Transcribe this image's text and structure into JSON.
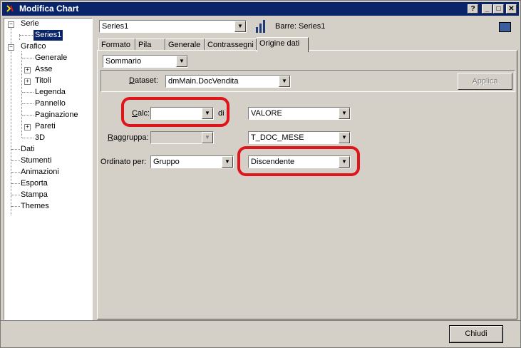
{
  "window": {
    "title": "Modifica Chart",
    "help_btn": "?",
    "min_btn": "_",
    "max_btn": "□",
    "close_btn": "✕"
  },
  "tree": {
    "items": [
      {
        "label": "Serie"
      },
      {
        "label": "Series1"
      },
      {
        "label": "Grafico"
      },
      {
        "label": "Generale"
      },
      {
        "label": "Asse"
      },
      {
        "label": "Titoli"
      },
      {
        "label": "Legenda"
      },
      {
        "label": "Pannello"
      },
      {
        "label": "Paginazione"
      },
      {
        "label": "Pareti"
      },
      {
        "label": "3D"
      },
      {
        "label": "Dati"
      },
      {
        "label": "Stumenti"
      },
      {
        "label": "Animazioni"
      },
      {
        "label": "Esporta"
      },
      {
        "label": "Stampa"
      },
      {
        "label": "Themes"
      }
    ],
    "expand": "−",
    "collapse": "+"
  },
  "series_bar": {
    "series_value": "Series1",
    "series_type": "Barre: Series1",
    "swatch_color": "#3a5f9e"
  },
  "tabs": [
    "Formato",
    "Pila",
    "Generale",
    "Contrassegni",
    "Origine dati"
  ],
  "origine": {
    "mode_value": "Sommario",
    "dataset_label_u": "D",
    "dataset_label_rest": "ataset:",
    "dataset_value": "dmMain.DocVendita",
    "apply_label": "Applica",
    "calc_label_u": "C",
    "calc_label_rest": "alc:",
    "calc_value": "",
    "di_label": "di",
    "valore_value": "VALORE",
    "raggruppa_label_u": "R",
    "raggruppa_label_rest": "aggruppa:",
    "raggruppa_value": "",
    "tdoc_value": "T_DOC_MESE",
    "ordinato_label_pre": "O",
    "ordinato_label_rest": "rdinato per:",
    "ordinato_value": "Gruppo",
    "direction_value": "Discendente"
  },
  "footer": {
    "close_label": "Chiudi"
  },
  "colors": {
    "title_bg": "#0a246a",
    "highlight": "#e0151b",
    "face": "#d4d0c8"
  },
  "icons": {
    "dropdown": "▼"
  }
}
